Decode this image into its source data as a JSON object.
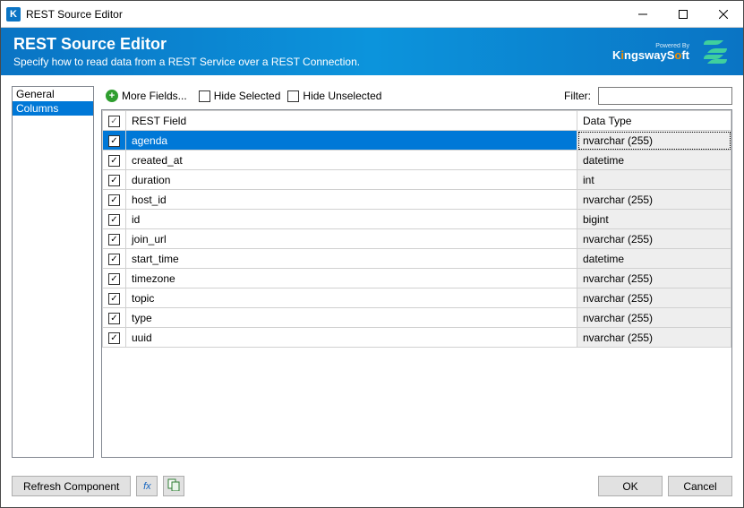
{
  "window": {
    "title": "REST Source Editor"
  },
  "header": {
    "title": "REST Source Editor",
    "subtitle": "Specify how to read data from a REST Service over a REST Connection.",
    "powered_by": "Powered By",
    "brand": "KingswaySoft"
  },
  "sidebar": {
    "items": [
      {
        "label": "General",
        "selected": false
      },
      {
        "label": "Columns",
        "selected": true
      }
    ]
  },
  "toolbar": {
    "more_fields_label": "More Fields...",
    "hide_selected_label": "Hide Selected",
    "hide_unselected_label": "Hide Unselected",
    "filter_label": "Filter:",
    "filter_value": ""
  },
  "grid": {
    "headers": {
      "check": "",
      "field": "REST Field",
      "type": "Data Type"
    },
    "rows": [
      {
        "checked": true,
        "field": "agenda",
        "type": "nvarchar (255)",
        "selected": true
      },
      {
        "checked": true,
        "field": "created_at",
        "type": "datetime",
        "selected": false
      },
      {
        "checked": true,
        "field": "duration",
        "type": "int",
        "selected": false
      },
      {
        "checked": true,
        "field": "host_id",
        "type": "nvarchar (255)",
        "selected": false
      },
      {
        "checked": true,
        "field": "id",
        "type": "bigint",
        "selected": false
      },
      {
        "checked": true,
        "field": "join_url",
        "type": "nvarchar (255)",
        "selected": false
      },
      {
        "checked": true,
        "field": "start_time",
        "type": "datetime",
        "selected": false
      },
      {
        "checked": true,
        "field": "timezone",
        "type": "nvarchar (255)",
        "selected": false
      },
      {
        "checked": true,
        "field": "topic",
        "type": "nvarchar (255)",
        "selected": false
      },
      {
        "checked": true,
        "field": "type",
        "type": "nvarchar (255)",
        "selected": false
      },
      {
        "checked": true,
        "field": "uuid",
        "type": "nvarchar (255)",
        "selected": false
      }
    ]
  },
  "footer": {
    "refresh_label": "Refresh Component",
    "ok_label": "OK",
    "cancel_label": "Cancel"
  }
}
